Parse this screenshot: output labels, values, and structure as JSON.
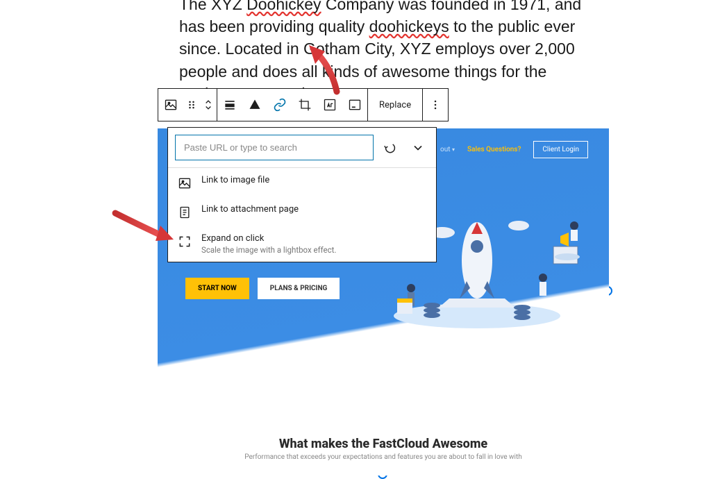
{
  "content": {
    "p1_a": "The XYZ ",
    "p1_b": "Doohickey",
    "p1_c": " Company was founded in 1971, and has been providing quality ",
    "p1_d": "doohickeys",
    "p1_e": " to the public ever since. Located in Gotham City, XYZ employs over 2,000 people and does all kinds of ",
    "p1_f": "awesome",
    "p1_g": " things for the Gotham community."
  },
  "toolbar": {
    "replace": "Replace"
  },
  "link_popover": {
    "search_placeholder": "Paste URL or type to search",
    "opt_image_file": "Link to image file",
    "opt_attachment": "Link to attachment page",
    "opt_expand": "Expand on click",
    "opt_expand_desc": "Scale the image with a lightbox effect."
  },
  "preview": {
    "nav_about": "out",
    "nav_sales": "Sales Questions?",
    "nav_login": "Client Login",
    "cta_start": "START NOW",
    "cta_plans": "PLANS & PRICING",
    "heading": "What makes the FastCloud Awesome",
    "subheading": "Performance that exceeds your expectations and features you are about to fall in love with"
  },
  "colors": {
    "link_active": "#0073aa",
    "arrow": "#d63638",
    "preview_bg": "#3c8de5",
    "cta_yellow": "#ffc107"
  }
}
